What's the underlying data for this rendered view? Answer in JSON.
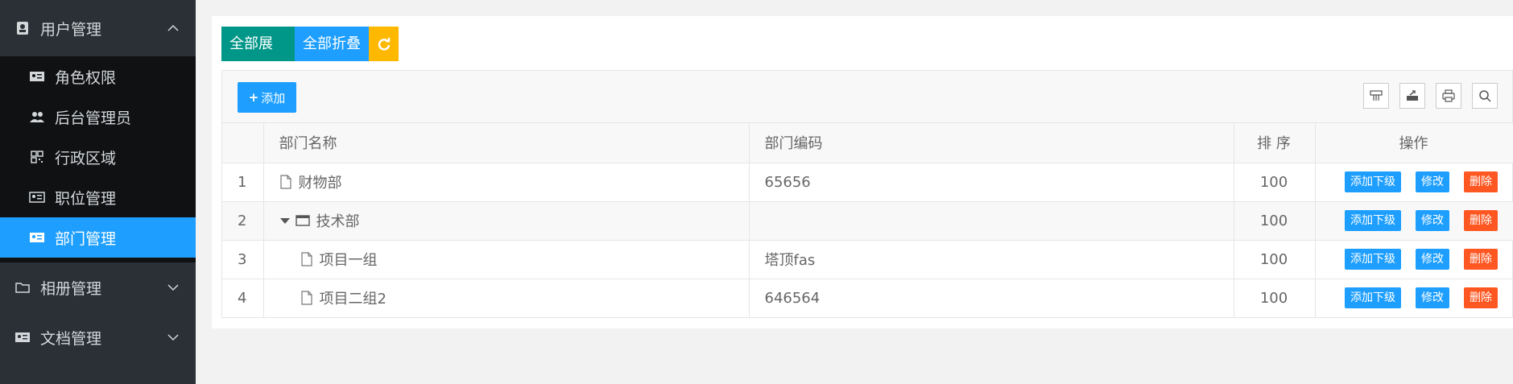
{
  "sidebar": {
    "groups": [
      {
        "label": "用户管理",
        "expanded": true
      },
      {
        "label": "相册管理",
        "expanded": false
      },
      {
        "label": "文档管理",
        "expanded": false
      }
    ],
    "items": [
      {
        "label": "角色权限"
      },
      {
        "label": "后台管理员"
      },
      {
        "label": "行政区域"
      },
      {
        "label": "职位管理"
      },
      {
        "label": "部门管理",
        "active": true
      }
    ]
  },
  "toolbar": {
    "expand_all": "全部展开",
    "collapse_all": "全部折叠",
    "add": "添加"
  },
  "table": {
    "columns": [
      "部门名称",
      "部门编码",
      "排 序",
      "操作"
    ],
    "rows": [
      {
        "index": "1",
        "name": "财物部",
        "code": "65656",
        "sort": "100",
        "indent": 0,
        "type": "file"
      },
      {
        "index": "2",
        "name": "技术部",
        "code": "",
        "sort": "100",
        "indent": 0,
        "type": "folder"
      },
      {
        "index": "3",
        "name": "项目一组",
        "code": "塔顶fas",
        "sort": "100",
        "indent": 1,
        "type": "file"
      },
      {
        "index": "4",
        "name": "项目二组2",
        "code": "646564",
        "sort": "100",
        "indent": 1,
        "type": "file"
      }
    ],
    "actions": {
      "add_child": "添加下级",
      "edit": "修改",
      "delete": "删除"
    }
  },
  "colors": {
    "sidebar_bg": "#2b3036",
    "active": "#1e9fff",
    "green": "#009688",
    "yellow": "#ffb800",
    "danger": "#ff5722"
  }
}
